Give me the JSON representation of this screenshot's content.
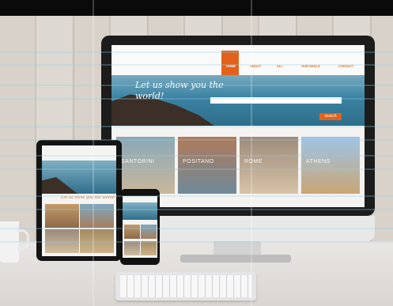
{
  "monitor_site": {
    "nav": [
      "HOME",
      "ABOUT",
      "ALL",
      "OUR DEALS",
      "CONTACT"
    ],
    "hero_text": "Let us show you the world!",
    "search_button": "search",
    "gallery": [
      "SANTORINI",
      "POSITANO",
      "ROME",
      "ATHENS"
    ]
  },
  "tablet_site": {
    "caption": "Let us show you the world!"
  },
  "colors": {
    "accent": "#e2621b",
    "sea": "#2f6e8a",
    "device_frame": "#1c1c1c"
  }
}
